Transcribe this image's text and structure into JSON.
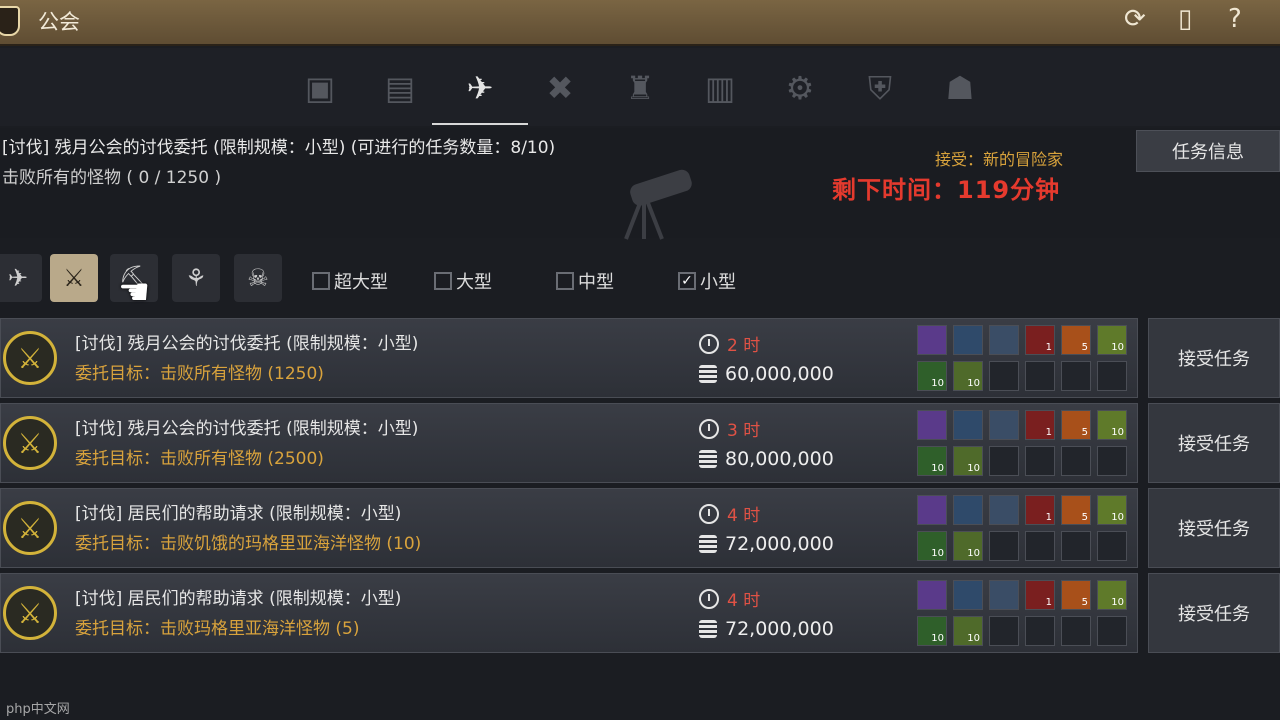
{
  "window": {
    "title": "公会"
  },
  "tabs": [
    {
      "icon": "guild-info-icon",
      "glyph": "▣"
    },
    {
      "icon": "members-icon",
      "glyph": "▤"
    },
    {
      "icon": "quest-cannon-icon",
      "glyph": "✈",
      "active": true
    },
    {
      "icon": "crossed-tools-icon",
      "glyph": "✖"
    },
    {
      "icon": "tower-icon",
      "glyph": "♜"
    },
    {
      "icon": "book-icon",
      "glyph": "▥"
    },
    {
      "icon": "ship-icon",
      "glyph": "⚙"
    },
    {
      "icon": "armor-icon",
      "glyph": "⛨"
    },
    {
      "icon": "helmet-icon",
      "glyph": "☗"
    }
  ],
  "info": {
    "title": "[讨伐] 残月公会的讨伐委托 (限制规模：小型) (可进行的任务数量：8/10)",
    "progress": "击败所有的怪物 ( 0 / 1250 )",
    "accepted": "接受：新的冒险家",
    "remaining": "剩下时间：119分钟",
    "quest_info_button": "任务信息"
  },
  "filters": {
    "checks": [
      {
        "label": "超大型",
        "checked": false
      },
      {
        "label": "大型",
        "checked": false
      },
      {
        "label": "中型",
        "checked": false
      },
      {
        "label": "小型",
        "checked": true
      }
    ]
  },
  "quests": [
    {
      "title": "[讨伐] 残月公会的讨伐委托 (限制规模：小型)",
      "goal": "委托目标：击败所有怪物 (1250)",
      "time": "2 时",
      "money": "60,000,000",
      "accept": "接受任务"
    },
    {
      "title": "[讨伐] 残月公会的讨伐委托 (限制规模：小型)",
      "goal": "委托目标：击败所有怪物 (2500)",
      "time": "3 时",
      "money": "80,000,000",
      "accept": "接受任务"
    },
    {
      "title": "[讨伐] 居民们的帮助请求 (限制规模：小型)",
      "goal": "委托目标：击败饥饿的玛格里亚海洋怪物 (10)",
      "time": "4 时",
      "money": "72,000,000",
      "accept": "接受任务"
    },
    {
      "title": "[讨伐] 居民们的帮助请求 (限制规模：小型)",
      "goal": "委托目标：击败玛格里亚海洋怪物 (5)",
      "time": "4 时",
      "money": "72,000,000",
      "accept": "接受任务"
    }
  ],
  "reward_slot_colors": [
    "#5a3a8a",
    "#2f4a6a",
    "#3a4d66",
    "#7a1f1f",
    "#a8501a",
    "#5f7a2a",
    "#2f5f2a",
    "#4f6a2a"
  ],
  "reward_counts_top": [
    "",
    "",
    "",
    "1",
    "5",
    "10"
  ],
  "reward_counts_bottom": [
    "10",
    "10"
  ],
  "watermark": "php中文网"
}
